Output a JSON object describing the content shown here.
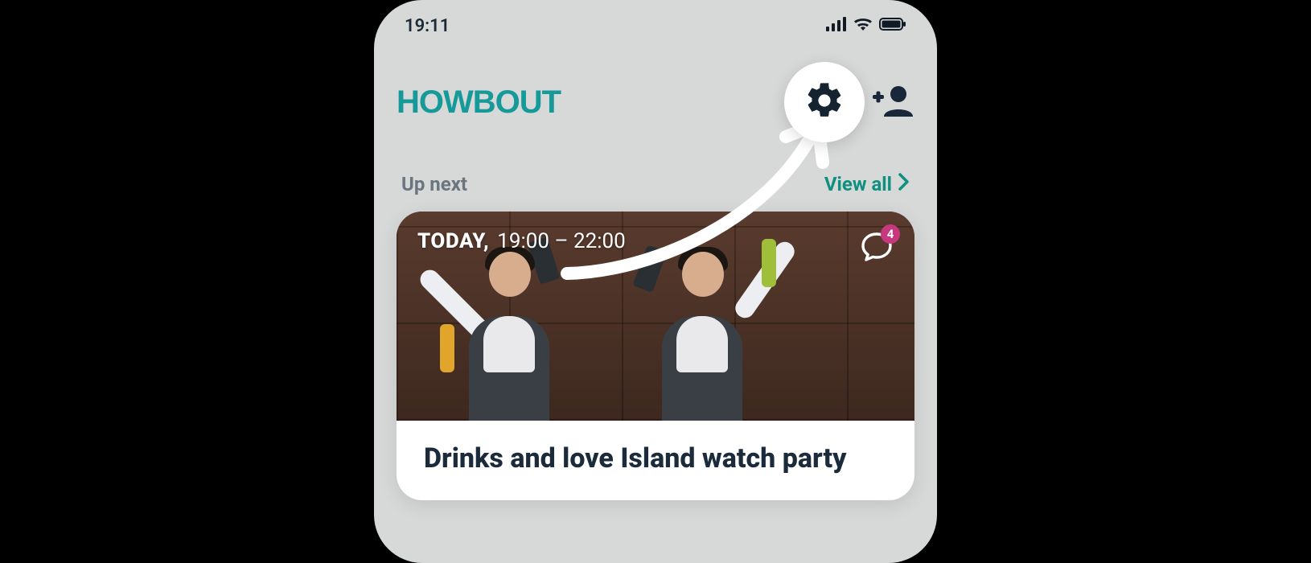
{
  "status": {
    "time": "19:11"
  },
  "header": {
    "logo": "HOWBOUT"
  },
  "section": {
    "up_next": "Up next",
    "view_all": "View all"
  },
  "event": {
    "day_label": "TODAY,",
    "time_range": "19:00 – 22:00",
    "chat_count": "4",
    "title": "Drinks and love Island watch party"
  }
}
